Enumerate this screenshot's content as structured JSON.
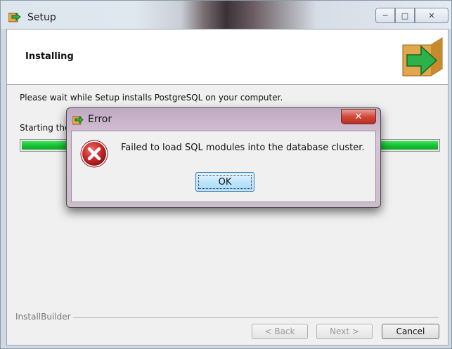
{
  "window": {
    "title": "Setup",
    "buttons": {
      "minimize": "─",
      "maximize": "□",
      "close": "✕"
    }
  },
  "header": {
    "title": "Installing"
  },
  "main": {
    "description": "Please wait while Setup installs PostgreSQL on your computer.",
    "status": "Starting the",
    "progress_fraction": 1.0
  },
  "footer": {
    "brand": "InstallBuilder",
    "back_label": "< Back",
    "next_label": "Next >",
    "cancel_label": "Cancel"
  },
  "dialog": {
    "title": "Error",
    "close_glyph": "✕",
    "message": "Failed to load SQL modules into the database cluster.",
    "ok_label": "OK"
  },
  "colors": {
    "progress": "#16c032",
    "error_icon": "#c62828",
    "dialog_frame": "#cdbccb"
  }
}
